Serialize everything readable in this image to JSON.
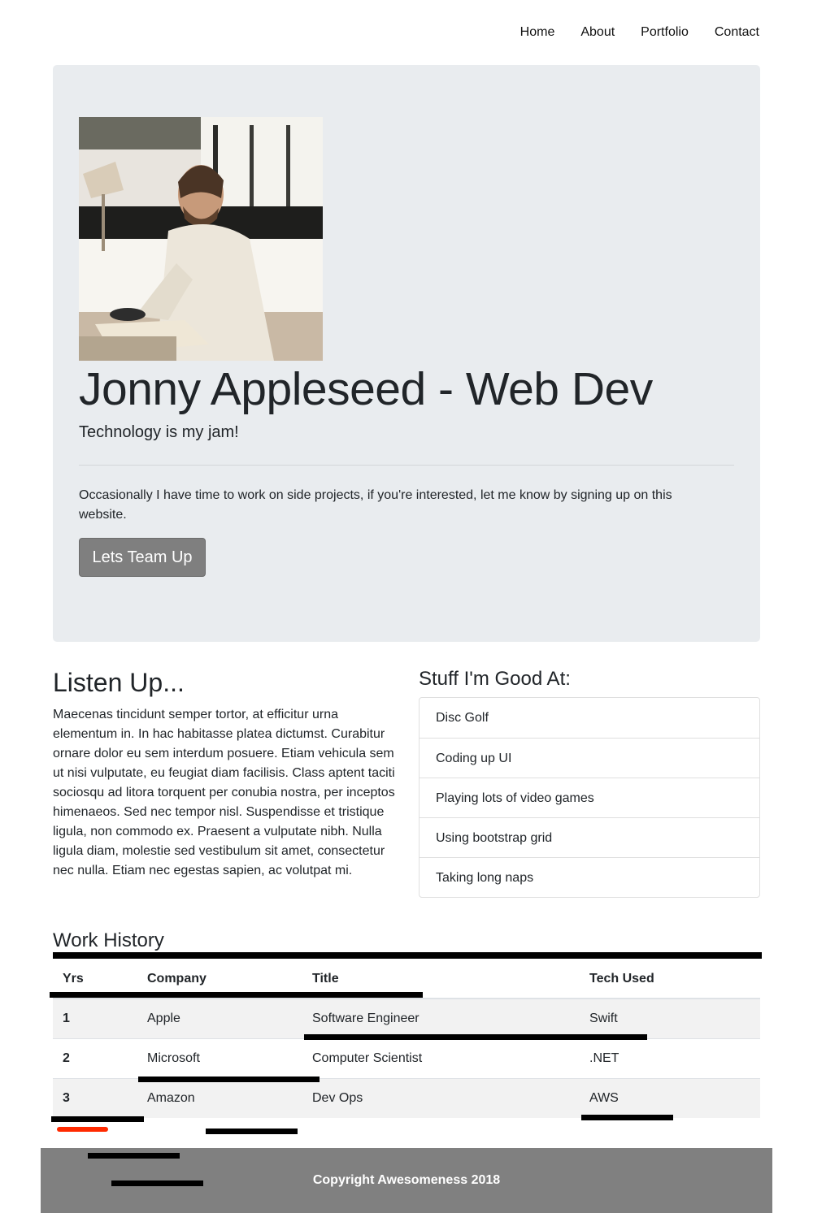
{
  "nav": {
    "items": [
      "Home",
      "About",
      "Portfolio",
      "Contact"
    ]
  },
  "hero": {
    "image_subject": "man-at-laptop-photo",
    "title": "Jonny Appleseed - Web Dev",
    "lead": "Technology is my jam!",
    "text": "Occasionally I have time to work on side projects, if you're interested, let me know by signing up on this website.",
    "button_label": "Lets Team Up"
  },
  "listen": {
    "heading": "Listen Up...",
    "paragraph": "Maecenas tincidunt semper tortor, at efficitur urna elementum in. In hac habitasse platea dictumst. Curabitur ornare dolor eu sem interdum posuere. Etiam vehicula sem ut nisi vulputate, eu feugiat diam facilisis. Class aptent taciti sociosqu ad litora torquent per conubia nostra, per inceptos himenaeos. Sed nec tempor nisl. Suspendisse et tristique ligula, non commodo ex. Praesent a vulputate nibh. Nulla ligula diam, molestie sed vestibulum sit amet, consectetur nec nulla. Etiam nec egestas sapien, ac volutpat mi."
  },
  "skills": {
    "heading": "Stuff I'm Good At:",
    "items": [
      "Disc Golf",
      "Coding up UI",
      "Playing lots of video games",
      "Using bootstrap grid",
      "Taking long naps"
    ]
  },
  "work": {
    "heading": "Work History",
    "columns": [
      "Yrs",
      "Company",
      "Title",
      "Tech Used"
    ],
    "rows": [
      [
        "1",
        "Apple",
        "Software Engineer",
        "Swift"
      ],
      [
        "2",
        "Microsoft",
        "Computer Scientist",
        ".NET"
      ],
      [
        "3",
        "Amazon",
        "Dev Ops",
        "AWS"
      ]
    ]
  },
  "footer": {
    "text": "Copyright Awesomeness 2018"
  },
  "colors": {
    "jumbotron_bg": "#e9ecef",
    "button_bg": "#7f7f7f",
    "footer_bg": "#808080",
    "annotation_marks": "#000000",
    "annotation_red": "#ff2a00"
  }
}
